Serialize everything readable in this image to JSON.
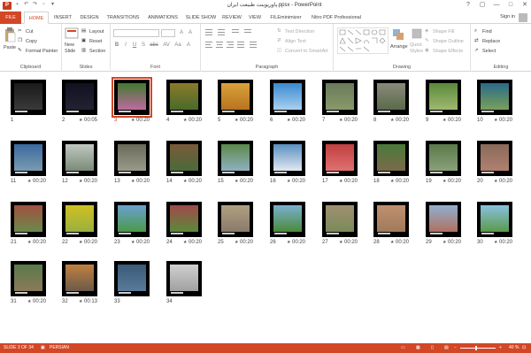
{
  "window": {
    "title": "پاورپوینت طبیعت ایران.ppsx - PowerPoint",
    "controls": [
      "?",
      "▢",
      "—",
      "□",
      "✕"
    ]
  },
  "tabs": [
    {
      "label": "FILE",
      "key": "file"
    },
    {
      "label": "HOME",
      "key": "home"
    },
    {
      "label": "INSERT",
      "key": "insert"
    },
    {
      "label": "DESIGN",
      "key": "design"
    },
    {
      "label": "TRANSITIONS",
      "key": "transitions"
    },
    {
      "label": "ANIMATIONS",
      "key": "animations"
    },
    {
      "label": "SLIDE SHOW",
      "key": "slideshow"
    },
    {
      "label": "REVIEW",
      "key": "review"
    },
    {
      "label": "VIEW",
      "key": "view"
    },
    {
      "label": "FILEminimizer",
      "key": "fileminimizer"
    },
    {
      "label": "Nitro PDF Professional",
      "key": "nitro"
    }
  ],
  "account": {
    "signin": "Sign in"
  },
  "ribbon": {
    "clipboard": {
      "label": "Clipboard",
      "paste": "Paste",
      "cut": "Cut",
      "copy": "Copy",
      "format_painter": "Format Painter"
    },
    "slides": {
      "label": "Slides",
      "new_slide": "New",
      "new_slide2": "Slide",
      "layout": "Layout",
      "reset": "Reset",
      "section": "Section"
    },
    "font": {
      "label": "Font",
      "buttons": [
        "B",
        "I",
        "U",
        "S",
        "abc",
        "AV",
        "Aa",
        "A"
      ]
    },
    "paragraph": {
      "label": "Paragraph",
      "text_direction": "Text Direction",
      "align_text": "Align Text",
      "convert_smartart": "Convert to SmartArt"
    },
    "drawing": {
      "label": "Drawing",
      "arrange": "Arrange",
      "quick_styles": "Quick",
      "quick_styles2": "Styles",
      "shape_fill": "Shape Fill",
      "shape_outline": "Shape Outline",
      "shape_effects": "Shape Effects"
    },
    "editing": {
      "label": "Editing",
      "find": "Find",
      "replace": "Replace",
      "select": "Select"
    }
  },
  "slides": [
    {
      "num": "1",
      "time": "",
      "colors": [
        "#1a1a1a",
        "#3a3a3a"
      ],
      "selected": false
    },
    {
      "num": "2",
      "time": "00:05",
      "colors": [
        "#111122",
        "#222233"
      ],
      "selected": false
    },
    {
      "num": "3",
      "time": "00:20",
      "colors": [
        "#3f7a2f",
        "#c06aa0"
      ],
      "selected": true
    },
    {
      "num": "4",
      "time": "00:20",
      "colors": [
        "#8a7a2a",
        "#4a6a2a"
      ],
      "selected": false
    },
    {
      "num": "5",
      "time": "00:20",
      "colors": [
        "#d9a23a",
        "#b8731f"
      ],
      "selected": false
    },
    {
      "num": "6",
      "time": "00:20",
      "colors": [
        "#3a8ad0",
        "#a8d0f0"
      ],
      "selected": false
    },
    {
      "num": "7",
      "time": "00:20",
      "colors": [
        "#6a7a5a",
        "#8a9a6a"
      ],
      "selected": false
    },
    {
      "num": "8",
      "time": "00:20",
      "colors": [
        "#8a8a7a",
        "#5a6a4a"
      ],
      "selected": false
    },
    {
      "num": "9",
      "time": "00:20",
      "colors": [
        "#5a8a3a",
        "#a0b870"
      ],
      "selected": false
    },
    {
      "num": "10",
      "time": "00:20",
      "colors": [
        "#2a6a8a",
        "#7aa05a"
      ],
      "selected": false
    },
    {
      "num": "11",
      "time": "00:20",
      "colors": [
        "#3a6aa0",
        "#7a9ab0"
      ],
      "selected": false
    },
    {
      "num": "12",
      "time": "00:20",
      "colors": [
        "#c0c8c0",
        "#7a8a7a"
      ],
      "selected": false
    },
    {
      "num": "13",
      "time": "00:20",
      "colors": [
        "#6a6a5a",
        "#9a9a8a"
      ],
      "selected": false
    },
    {
      "num": "14",
      "time": "00:20",
      "colors": [
        "#7a5a3a",
        "#4a6a3a"
      ],
      "selected": false
    },
    {
      "num": "15",
      "time": "00:20",
      "colors": [
        "#5a8a4a",
        "#90b0c0"
      ],
      "selected": false
    },
    {
      "num": "16",
      "time": "00:20",
      "colors": [
        "#5a90c0",
        "#e0e8f0"
      ],
      "selected": false
    },
    {
      "num": "17",
      "time": "00:20",
      "colors": [
        "#c04040",
        "#e07070"
      ],
      "selected": false
    },
    {
      "num": "18",
      "time": "00:20",
      "colors": [
        "#4a7a3a",
        "#7a6a4a"
      ],
      "selected": false
    },
    {
      "num": "19",
      "time": "00:20",
      "colors": [
        "#5a7a4a",
        "#8aa07a"
      ],
      "selected": false
    },
    {
      "num": "20",
      "time": "00:20",
      "colors": [
        "#8a6a5a",
        "#b08070"
      ],
      "selected": false
    },
    {
      "num": "21",
      "time": "00:20",
      "colors": [
        "#a05040",
        "#6a8a4a"
      ],
      "selected": false
    },
    {
      "num": "22",
      "time": "00:20",
      "colors": [
        "#d0c020",
        "#9ab040"
      ],
      "selected": false
    },
    {
      "num": "23",
      "time": "00:20",
      "colors": [
        "#6aa0d0",
        "#4a9a4a"
      ],
      "selected": false
    },
    {
      "num": "24",
      "time": "00:20",
      "colors": [
        "#a04a4a",
        "#5a8a3a"
      ],
      "selected": false
    },
    {
      "num": "25",
      "time": "00:20",
      "colors": [
        "#b0a080",
        "#8a7a6a"
      ],
      "selected": false
    },
    {
      "num": "26",
      "time": "00:20",
      "colors": [
        "#7ab0d0",
        "#4a8a3a"
      ],
      "selected": false
    },
    {
      "num": "27",
      "time": "00:20",
      "colors": [
        "#a09070",
        "#7a8a5a"
      ],
      "selected": false
    },
    {
      "num": "28",
      "time": "00:20",
      "colors": [
        "#c09070",
        "#a07a5a"
      ],
      "selected": false
    },
    {
      "num": "29",
      "time": "00:20",
      "colors": [
        "#90b0d0",
        "#b07060"
      ],
      "selected": false
    },
    {
      "num": "30",
      "time": "00:20",
      "colors": [
        "#8ac0e0",
        "#5a9a4a"
      ],
      "selected": false
    },
    {
      "num": "31",
      "time": "00:20",
      "colors": [
        "#5a7a4a",
        "#8a7a5a"
      ],
      "selected": false
    },
    {
      "num": "32",
      "time": "00:13",
      "colors": [
        "#c08040",
        "#6a5a4a"
      ],
      "selected": false
    },
    {
      "num": "33",
      "time": "",
      "colors": [
        "#3a5a7a",
        "#5a7a9a"
      ],
      "selected": false
    },
    {
      "num": "34",
      "time": "",
      "colors": [
        "#d0d0d0",
        "#a0a0a0"
      ],
      "selected": false
    }
  ],
  "status": {
    "slide_info": "SLIDE 3 OF 34",
    "language": "PERSIAN",
    "zoom": "40 %"
  },
  "colors": {
    "accent": "#d24726",
    "status_bar": "#d24726"
  }
}
